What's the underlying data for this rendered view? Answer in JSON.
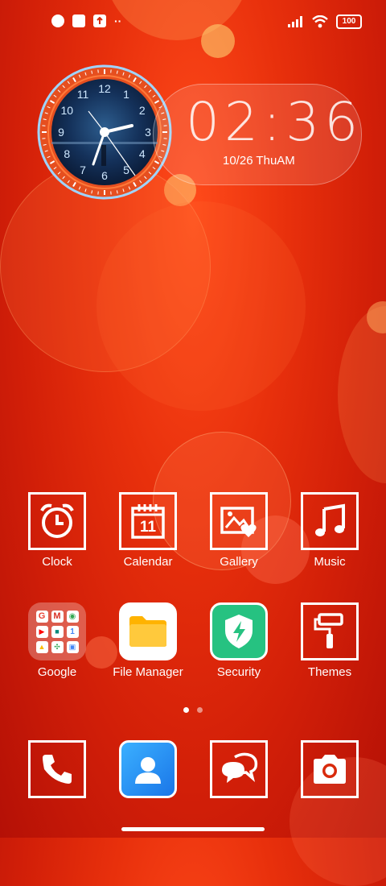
{
  "status": {
    "battery": "100"
  },
  "widget": {
    "clock_numbers": [
      "12",
      "1",
      "2",
      "3",
      "4",
      "5",
      "6",
      "7",
      "8",
      "9",
      "10",
      "11"
    ],
    "time": "02:36",
    "date": "10/26 ThuAM"
  },
  "apps_row1": [
    {
      "label": "Clock",
      "icon": "alarm-clock-icon"
    },
    {
      "label": "Calendar",
      "icon": "calendar-icon",
      "day": "11"
    },
    {
      "label": "Gallery",
      "icon": "gallery-icon"
    },
    {
      "label": "Music",
      "icon": "music-note-icon"
    }
  ],
  "apps_row2": [
    {
      "label": "Google",
      "icon": "google-folder-icon"
    },
    {
      "label": "File Manager",
      "icon": "folder-icon"
    },
    {
      "label": "Security",
      "icon": "shield-icon"
    },
    {
      "label": "Themes",
      "icon": "paint-roller-icon"
    }
  ],
  "dock": [
    {
      "icon": "phone-icon"
    },
    {
      "icon": "contacts-icon"
    },
    {
      "icon": "messages-icon"
    },
    {
      "icon": "camera-icon"
    }
  ],
  "pages": {
    "count": 2,
    "current": 1
  }
}
